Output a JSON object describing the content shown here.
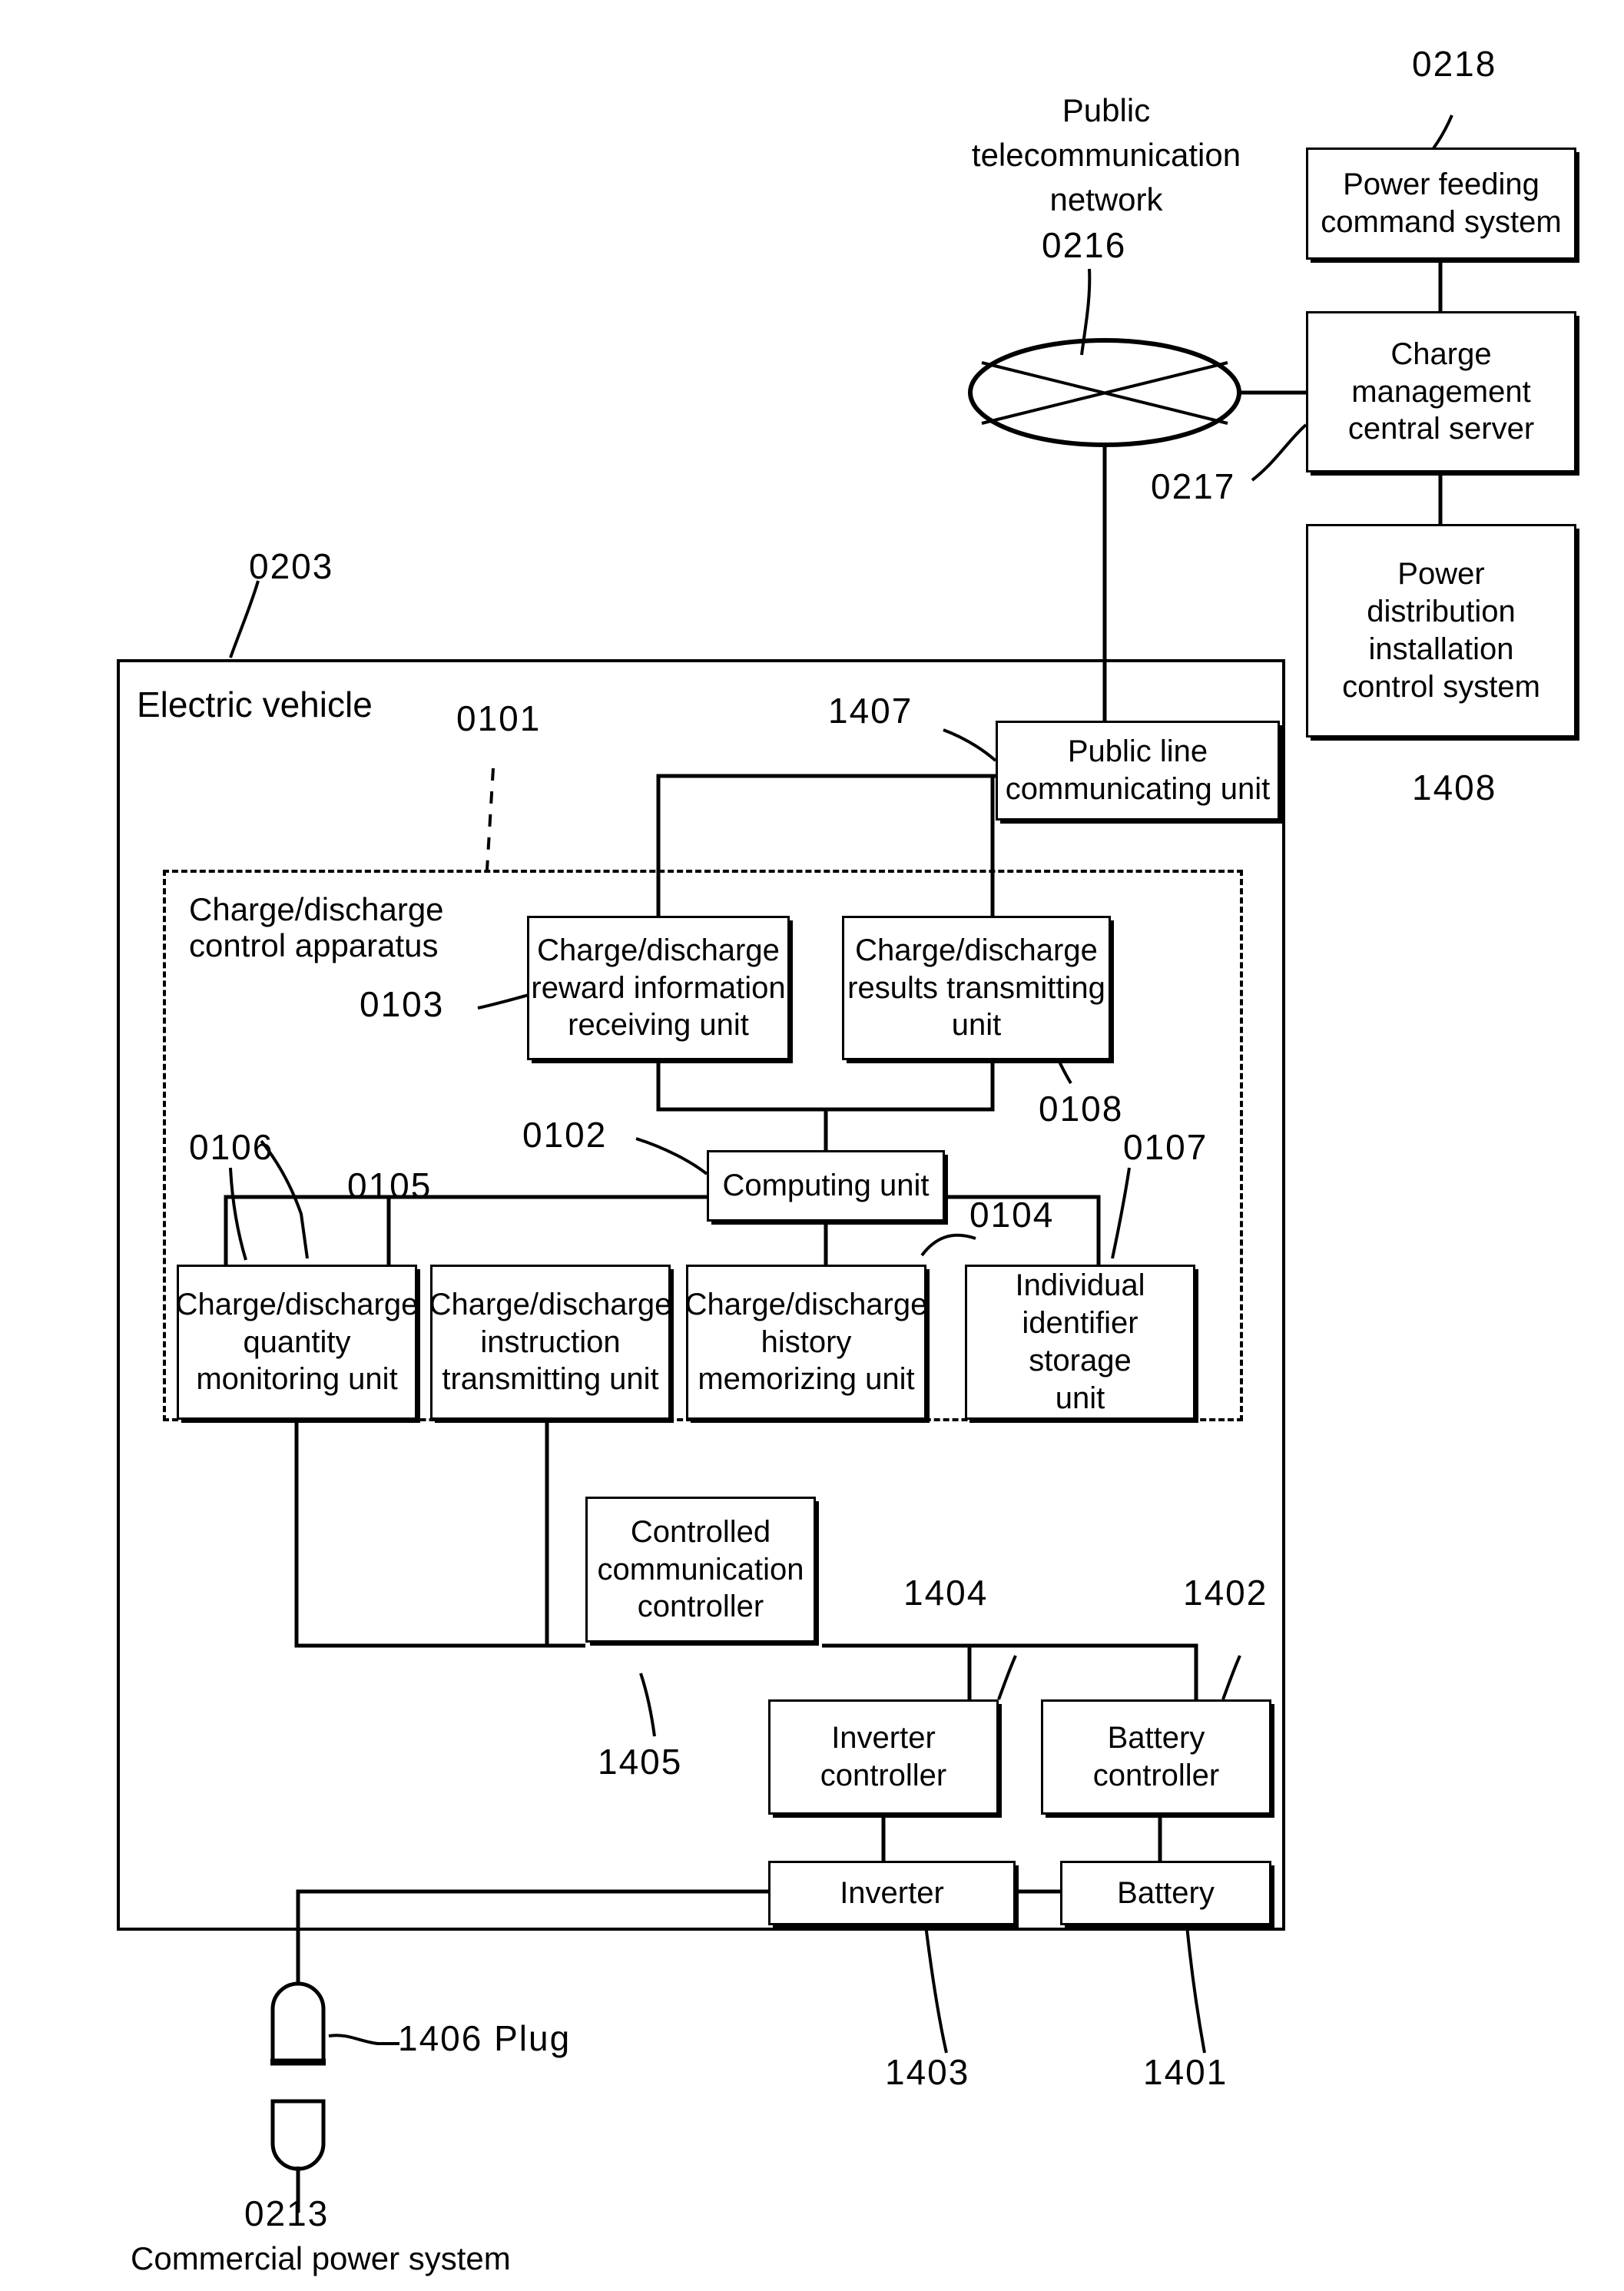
{
  "figure": {
    "title": "Electric vehicle charge/discharge control apparatus block diagram",
    "type": "patent-block-diagram"
  },
  "network": {
    "cloud_label_line1": "Public",
    "cloud_label_line2": "telecommunication",
    "cloud_label_line3": "network",
    "cloud_ref": "0216"
  },
  "refs": {
    "r0218": "0218",
    "r0217": "0217",
    "r1408": "1408",
    "r0203": "0203",
    "r0101": "0101",
    "r1407": "1407",
    "r0103": "0103",
    "r0108": "0108",
    "r0102": "0102",
    "r0106": "0106",
    "r0105": "0105",
    "r0104": "0104",
    "r0107": "0107",
    "r1405": "1405",
    "r1404": "1404",
    "r1402": "1402",
    "r1403": "1403",
    "r1401": "1401",
    "r1406_plug": "1406 Plug",
    "r0213": "0213"
  },
  "boxes": {
    "power_feeding_command_system": "Power feeding\ncommand system",
    "charge_management_central_server": "Charge\nmanagement\ncentral server",
    "power_distribution_installation_control_system": "Power\ndistribution\ninstallation\ncontrol system",
    "public_line_communicating_unit": "Public line\ncommunicating unit",
    "charge_discharge_reward_information_receiving_unit": "Charge/discharge\nreward information\nreceiving unit",
    "charge_discharge_results_transmitting_unit": "Charge/discharge\nresults transmitting\nunit",
    "computing_unit": "Computing unit",
    "charge_discharge_quantity_monitoring_unit": "Charge/discharge\nquantity\nmonitoring unit",
    "charge_discharge_instruction_transmitting_unit": "Charge/discharge\ninstruction\ntransmitting unit",
    "charge_discharge_history_memorizing_unit": "Charge/discharge\nhistory\nmemorizing unit",
    "individual_identifier_storage_unit": "Individual\nidentifier storage\nunit",
    "controlled_communication_controller": "Controlled\ncommunication\ncontroller",
    "inverter_controller": "Inverter\ncontroller",
    "battery_controller": "Battery\ncontroller",
    "inverter": "Inverter",
    "battery": "Battery"
  },
  "containers": {
    "electric_vehicle": "Electric vehicle",
    "charge_discharge_control_apparatus": "Charge/discharge\ncontrol apparatus"
  },
  "bottom": {
    "commercial_power_system": "Commercial power system"
  },
  "colors": {
    "stroke": "#000000",
    "background": "#ffffff"
  }
}
